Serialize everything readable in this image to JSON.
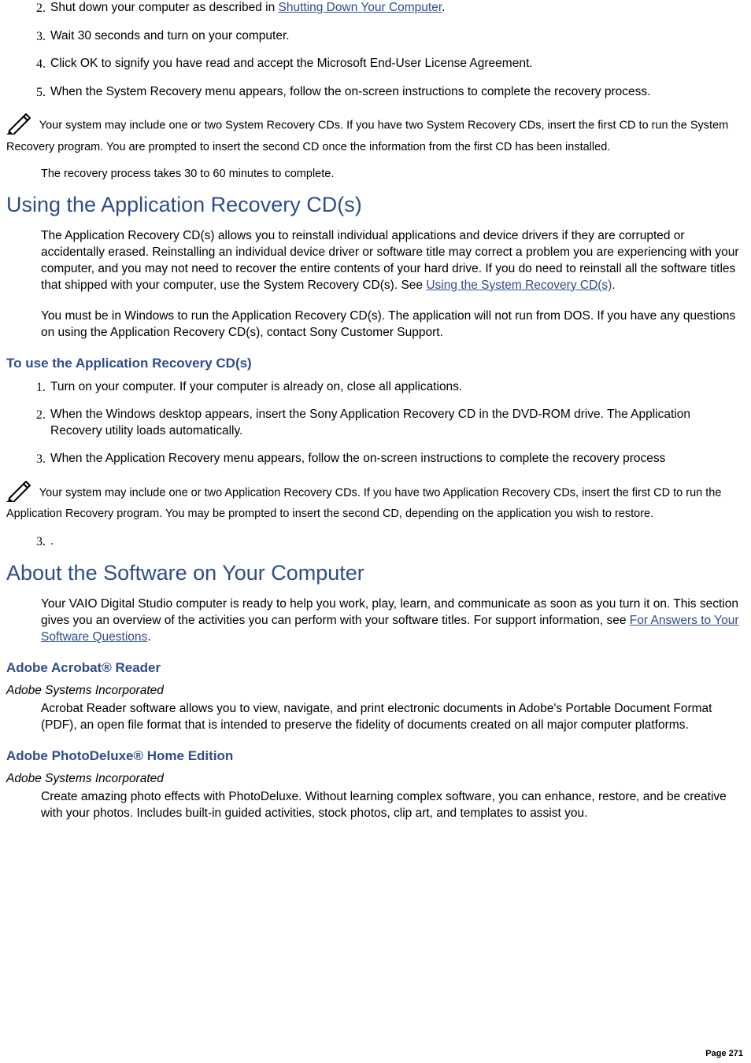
{
  "list1": {
    "items": [
      {
        "num": "2.",
        "pre": "Shut down your computer as described in ",
        "link": "Shutting Down Your Computer",
        "post": "."
      },
      {
        "num": "3.",
        "text": "Wait 30 seconds and turn on your computer."
      },
      {
        "num": "4.",
        "text": "Click OK to signify you have read and accept the Microsoft End-User License Agreement."
      },
      {
        "num": "5.",
        "text": "When the System Recovery menu appears, follow the on-screen instructions to complete the recovery process."
      }
    ]
  },
  "note1": " Your system may include one or two System Recovery CDs. If you have two System Recovery CDs, insert the first CD to run the System Recovery program. You are prompted to insert the second CD once the information from the first CD has been installed.",
  "para1": "The recovery process takes 30 to 60 minutes to complete.",
  "heading1": "Using the Application Recovery CD(s)",
  "body1": {
    "pre": "The Application Recovery CD(s) allows you to reinstall individual applications and device drivers if they are corrupted or accidentally erased. Reinstalling an individual device driver or software title may correct a problem you are experiencing with your computer, and you may not need to recover the entire contents of your hard drive. If you do need to reinstall all the software titles that shipped with your computer, use the System Recovery CD(s). See ",
    "link": "Using the System Recovery CD(s)",
    "post": "."
  },
  "body2": "You must be in Windows to run the Application Recovery CD(s). The application will not run from DOS. If you have any questions on using the Application Recovery CD(s), contact Sony Customer Support.",
  "sub1": "To use the Application Recovery CD(s)",
  "list2": {
    "items": [
      {
        "num": "1.",
        "text": "Turn on your computer. If your computer is already on, close all applications."
      },
      {
        "num": "2.",
        "text": "When the Windows desktop appears, insert the Sony Application Recovery CD in the DVD-ROM drive. The Application Recovery utility loads automatically."
      },
      {
        "num": "3.",
        "text": "When the Application Recovery menu appears, follow the on-screen instructions to complete the recovery process"
      }
    ]
  },
  "note2": " Your system may include one or two Application Recovery CDs. If you have two Application Recovery CDs, insert the first CD to run the Application Recovery program. You may be prompted to insert the second CD, depending on the application you wish to restore.",
  "list3": {
    "num": "3.",
    "text": "."
  },
  "heading2": "About the Software on Your Computer",
  "body3": {
    "pre": "Your VAIO Digital Studio computer is ready to help you work, play, learn, and communicate as soon as you turn it on. This section gives you an overview of the activities you can perform with your software titles. For support information, see ",
    "link": "For Answers to Your Software Questions",
    "post": "."
  },
  "sw1": {
    "title": "Adobe Acrobat® Reader",
    "vendor": "Adobe Systems Incorporated",
    "desc": "Acrobat Reader software allows you to view, navigate, and print electronic documents in Adobe's Portable Document Format (PDF), an open file format that is intended to preserve the fidelity of documents created on all major computer platforms."
  },
  "sw2": {
    "title": "Adobe PhotoDeluxe® Home Edition",
    "vendor": "Adobe Systems Incorporated",
    "desc": "Create amazing photo effects with PhotoDeluxe. Without learning complex software, you can enhance, restore, and be creative with your photos. Includes built-in guided activities, stock photos, clip art, and templates to assist you."
  },
  "pagenum": "Page 271"
}
